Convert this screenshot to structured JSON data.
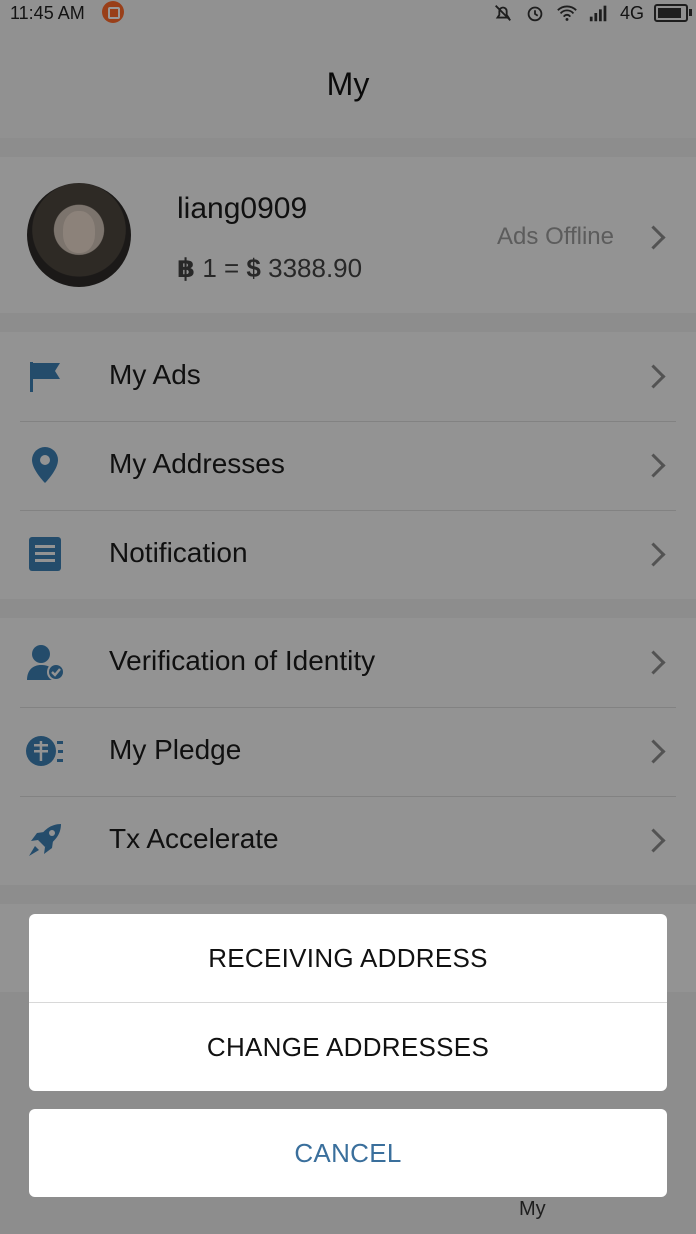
{
  "status_bar": {
    "time": "11:45 AM",
    "network": "4G",
    "battery_level": 0.9
  },
  "nav": {
    "title": "My"
  },
  "profile": {
    "username": "liang0909",
    "btc_symbol": "฿",
    "rate_middle": " 1 = ",
    "usd_symbol": "$",
    "rate_value": " 3388.90",
    "ads_status": "Ads Offline"
  },
  "menu_group1": [
    {
      "label": "My Ads",
      "icon": "flag-icon"
    },
    {
      "label": "My Addresses",
      "icon": "location-pin-icon"
    },
    {
      "label": "Notification",
      "icon": "document-icon"
    }
  ],
  "menu_group2": [
    {
      "label": "Verification of Identity",
      "icon": "user-verified-icon"
    },
    {
      "label": "My Pledge",
      "icon": "pledge-icon"
    },
    {
      "label": "Tx Accelerate",
      "icon": "rocket-icon"
    }
  ],
  "action_sheet": {
    "options": [
      "RECEIVING ADDRESS",
      "CHANGE ADDRESSES"
    ],
    "cancel": "CANCEL"
  },
  "tab_bar": {
    "my_label": "My"
  },
  "colors": {
    "icon_blue": "#3c7fb3",
    "cancel_blue": "#3a6f9c"
  }
}
